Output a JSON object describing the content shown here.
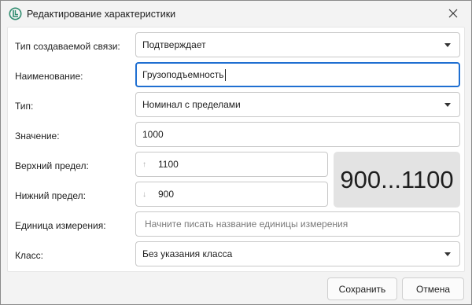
{
  "window": {
    "title": "Редактирование характеристики"
  },
  "form": {
    "link_type": {
      "label": "Тип создаваемой связи:",
      "value": "Подтверждает"
    },
    "name": {
      "label": "Наименование:",
      "value": "Грузоподъемность"
    },
    "type": {
      "label": "Тип:",
      "value": "Номинал с пределами"
    },
    "value": {
      "label": "Значение:",
      "value": "1000"
    },
    "upper_limit": {
      "label": "Верхний предел:",
      "value": "1100"
    },
    "lower_limit": {
      "label": "Нижний предел:",
      "value": "900"
    },
    "unit": {
      "label": "Единица измерения:",
      "placeholder": "Начните писать название единицы измерения"
    },
    "class": {
      "label": "Класс:",
      "value": "Без указания класса"
    },
    "range_display": "900...1100"
  },
  "buttons": {
    "save": "Сохранить",
    "cancel": "Отмена"
  },
  "colors": {
    "accent": "#1f6fd1",
    "app_icon": "#2e8b6e"
  }
}
